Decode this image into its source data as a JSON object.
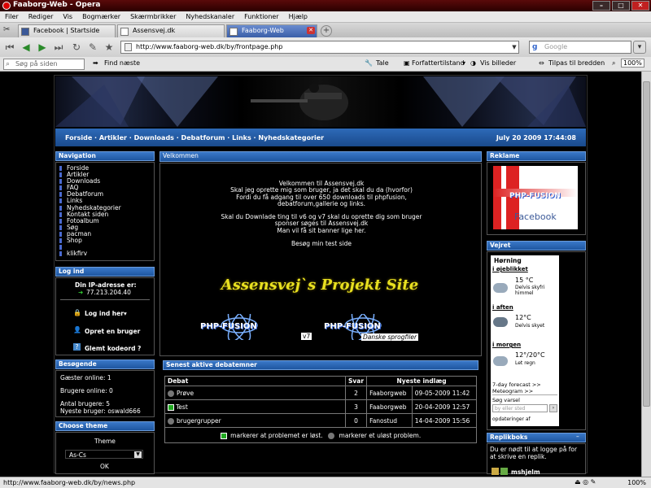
{
  "window": {
    "title": "Faaborg-Web - Opera"
  },
  "menu": [
    "Filer",
    "Rediger",
    "Vis",
    "Bogmærker",
    "Skærmbrikker",
    "Nyhedskanaler",
    "Funktioner",
    "Hjælp"
  ],
  "tabs": [
    {
      "label": "Facebook | Startside"
    },
    {
      "label": "Assensvej.dk"
    },
    {
      "label": "Faaborg-Web",
      "active": true
    }
  ],
  "address": {
    "url": "http://www.faaborg-web.dk/by/frontpage.php"
  },
  "search": {
    "placeholder": "Google"
  },
  "findbar": {
    "search_placeholder": "Søg på siden",
    "find_next": "Find næste",
    "speak": "Tale",
    "author_mode": "Forfattertilstand",
    "show_images": "Vis billeder",
    "fit_width": "Tilpas til bredden",
    "zoom": "100%"
  },
  "site": {
    "topnav": "Forside · Artikler · Downloads · Debatforum · Links · Nyhedskategorier",
    "date": "July 20 2009 17:44:08",
    "navigation": {
      "title": "Navigation",
      "items": [
        "Forside",
        "Artikler",
        "Downloads",
        "FAQ",
        "Debatforum",
        "Links",
        "Nyhedskategorier",
        "Kontakt siden",
        "Fotoalbum",
        "Søg",
        "pacman",
        "Shop",
        "",
        "klikfirv"
      ]
    },
    "login": {
      "title": "Log ind",
      "ip_label": "Din IP-adresse er:",
      "ip": "77.213.204.40",
      "login_here": "Log ind her",
      "register": "Opret en bruger",
      "forgot": "Glemt kodeord ?"
    },
    "visitors": {
      "title": "Besøgende",
      "guests": "Gæster online: 1",
      "users_online": "Brugere online: 0",
      "user_count": "Antal brugere: 5",
      "newest": "Nyeste bruger: oswald666"
    },
    "theme": {
      "title": "Choose theme",
      "label": "Theme",
      "value": "As-Cs",
      "ok": "OK"
    },
    "welcome": {
      "title": "Velkommen",
      "lines": [
        "Velkommen til Assensvej.dk",
        "Skal jeg oprette mig som bruger, ja det skal du da (hvorfor)",
        "Fordi du få adgang til over 650 downloads til phpfusion,",
        "debatforum,gallerie og links.",
        "",
        "Skal du Downlade ting til v6 og v7 skal du oprette dig som bruger",
        "sponser søges til Assensvej.dk",
        "Man vil få sit banner lige her.",
        "",
        "Besøg min test side"
      ],
      "banner_text": "Assensvej`s Projekt Site",
      "logo1_text": "PHP-FUSION",
      "logo1_badge": "v7",
      "logo2_text": "PHP-FUSION",
      "logo2_badge": "Danske sprogfiler"
    },
    "debates": {
      "title": "Senest aktive debatemner",
      "headers": [
        "Debat",
        "Svar",
        "Nyeste indlæg"
      ],
      "rows": [
        {
          "topic": "Prøve",
          "replies": "2",
          "user": "Faaborgweb",
          "date": "09-05-2009 11:42"
        },
        {
          "topic": "Test",
          "replies": "3",
          "user": "Faaborgweb",
          "date": "20-04-2009 12:57"
        },
        {
          "topic": "brugergrupper",
          "replies": "0",
          "user": "Fanostud",
          "date": "14-04-2009 15:56"
        }
      ],
      "legend_solved": "markerer at problemet er løst.",
      "legend_unsolved": "markerer et uløst problem."
    },
    "reklame": {
      "title": "Reklame",
      "ad_text": "Facebook",
      "logo_text": "PHP-FUSION"
    },
    "weather": {
      "title": "Vejret",
      "city": "Hørning",
      "now_label": "i øjeblikket",
      "now_temp": "15 °C",
      "now_desc1": "Delvis skyfri",
      "now_desc2": "himmel",
      "evening_label": "i aften",
      "evening_temp": "12°C",
      "evening_desc": "Delvis skyet",
      "tomorrow_label": "i morgen",
      "tomorrow_temp": "12°/20°C",
      "tomorrow_desc": "Let regn",
      "forecast_link": "7-day forecast >>",
      "meteogram_link": "Meteogram >>",
      "search_label": "Søg varsel",
      "search_placeholder": "by eller sted",
      "updated": "opdateringer af"
    },
    "shoutbox": {
      "title": "Replikboks",
      "notice": "Du er nødt til at logge på for at skrive en replik.",
      "user": "mshjelm"
    }
  },
  "status": {
    "url": "http://www.faaborg-web.dk/by/news.php",
    "zoom": "100%"
  }
}
